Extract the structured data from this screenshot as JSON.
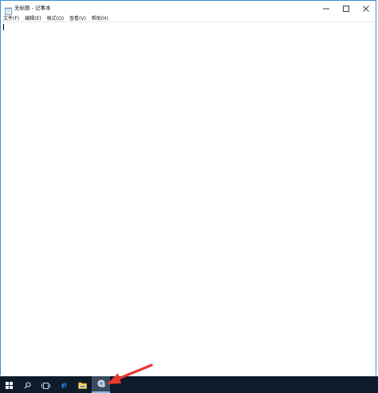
{
  "window": {
    "title": "无标题 - 记事本",
    "controls": {
      "minimize_icon": "minimize-icon",
      "maximize_icon": "maximize-icon",
      "close_icon": "close-icon"
    }
  },
  "menubar": {
    "items": [
      {
        "label": "文件(F)"
      },
      {
        "label": "编辑(E)"
      },
      {
        "label": "格式(O)"
      },
      {
        "label": "查看(V)"
      },
      {
        "label": "帮助(H)"
      }
    ]
  },
  "editor": {
    "content": ""
  },
  "taskbar": {
    "items": [
      {
        "icon": "windows-start-icon"
      },
      {
        "icon": "search-icon"
      },
      {
        "icon": "task-view-icon"
      },
      {
        "icon": "edge-browser-icon"
      },
      {
        "icon": "file-explorer-icon"
      },
      {
        "icon": "control-panel-icon",
        "active": true
      }
    ]
  },
  "colors": {
    "window_border": "#3a8fd9",
    "taskbar_bg": "#0e1b2b",
    "annotation_arrow": "#e8392f"
  }
}
